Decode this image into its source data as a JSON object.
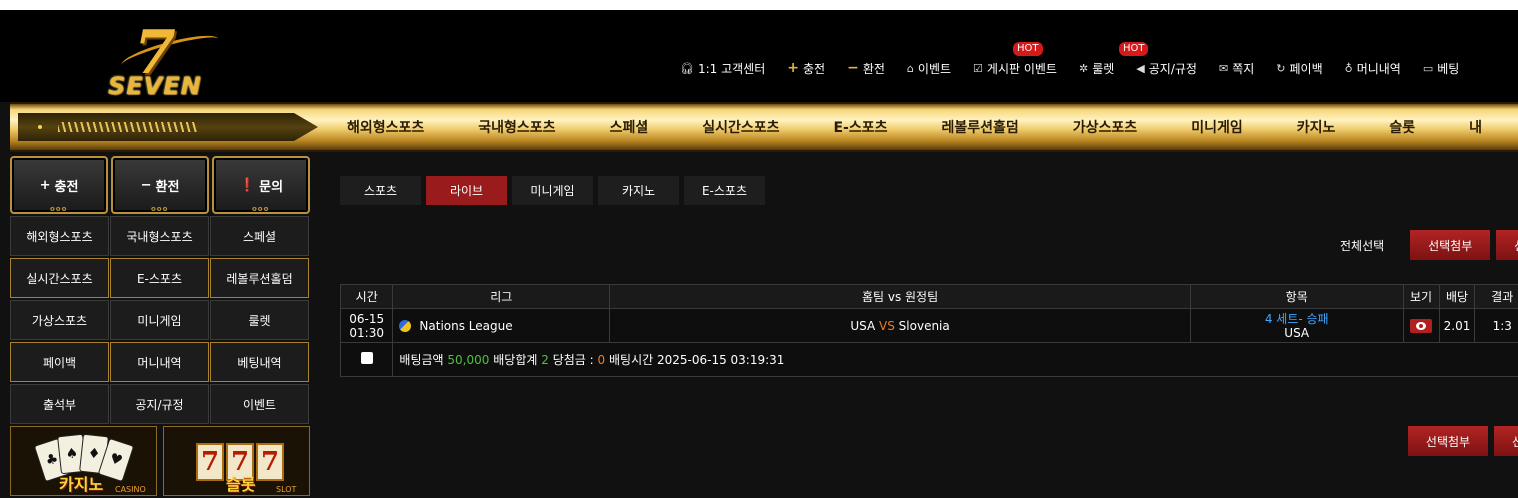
{
  "logo": {
    "number": "7",
    "text": "SEVEN"
  },
  "topnav": [
    {
      "icon": "headset-icon",
      "glyph": "🎧︎",
      "label": "1:1 고객센터",
      "hot": ""
    },
    {
      "icon": "plus-icon",
      "glyph": "+",
      "label": "충전",
      "hot": ""
    },
    {
      "icon": "minus-icon",
      "glyph": "−",
      "label": "환전",
      "hot": ""
    },
    {
      "icon": "gift-icon",
      "glyph": "⌂",
      "label": "이벤트",
      "hot": ""
    },
    {
      "icon": "checkbox-icon",
      "glyph": "☑",
      "label": "게시판 이벤트",
      "hot": "HOT"
    },
    {
      "icon": "roulette-icon",
      "glyph": "✲",
      "label": "룰렛",
      "hot": "HOT"
    },
    {
      "icon": "megaphone-icon",
      "glyph": "◀",
      "label": "공지/규정",
      "hot": ""
    },
    {
      "icon": "mail-icon",
      "glyph": "✉",
      "label": "쪽지",
      "hot": ""
    },
    {
      "icon": "refresh-icon",
      "glyph": "↻",
      "label": "페이백",
      "hot": ""
    },
    {
      "icon": "moneybag-icon",
      "glyph": "♁",
      "label": "머니내역",
      "hot": ""
    },
    {
      "icon": "ticket-icon",
      "glyph": "▭",
      "label": "베팅",
      "hot": ""
    }
  ],
  "mainnav": [
    "해외형스포츠",
    "국내형스포츠",
    "스페셜",
    "실시간스포츠",
    "E-스포츠",
    "레볼루션홀덤",
    "가상스포츠",
    "미니게임",
    "카지노",
    "슬롯",
    "내"
  ],
  "sidebar": {
    "top_buttons": [
      {
        "glyph": "+",
        "label": "충전",
        "icon": "plus-icon"
      },
      {
        "glyph": "−",
        "label": "환전",
        "icon": "minus-icon"
      },
      {
        "glyph": "❗",
        "label": "문의",
        "icon": "alert-icon"
      }
    ],
    "grid": [
      "해외형스포츠",
      "국내형스포츠",
      "스페셜",
      "실시간스포츠",
      "E-스포츠",
      "레볼루션홀덤",
      "가상스포츠",
      "미니게임",
      "룰렛",
      "페이백",
      "머니내역",
      "베팅내역",
      "출석부",
      "공지/규정",
      "이벤트"
    ],
    "banners": [
      {
        "label": "카지노",
        "sub": "CASINO"
      },
      {
        "label": "슬롯",
        "sub": "SLOT"
      }
    ]
  },
  "tabs": [
    "스포츠",
    "라이브",
    "미니게임",
    "카지노",
    "E-스포츠"
  ],
  "active_tab": 1,
  "actions": {
    "select_all": "전체선택",
    "attach": "선택첨부",
    "cut": "선"
  },
  "table": {
    "headers": [
      "시간",
      "리그",
      "홈팀 vs 원정팀",
      "항목",
      "보기",
      "배당",
      "결과"
    ],
    "row": {
      "date": "06-15",
      "time": "01:30",
      "league": "Nations League",
      "home": "USA",
      "vs": "VS",
      "away": "Slovenia",
      "market": "4 세트- 승패",
      "pick": "USA",
      "odds": "2.01",
      "result": "1:3"
    },
    "summary": {
      "amount_label": "배팅금액",
      "amount": "50,000",
      "total_label": "배당합계",
      "total": "2",
      "win_label": "당첨금 :",
      "win": "0",
      "time_label": "배팅시간",
      "time": "2025-06-15 03:19:31"
    }
  },
  "colors": {
    "accent_red": "#9a1b1b",
    "gold": "#e4b43a",
    "odds_green": "#4fc13f",
    "vs_orange": "#f07c1f",
    "pick_blue": "#3ea6ff"
  }
}
